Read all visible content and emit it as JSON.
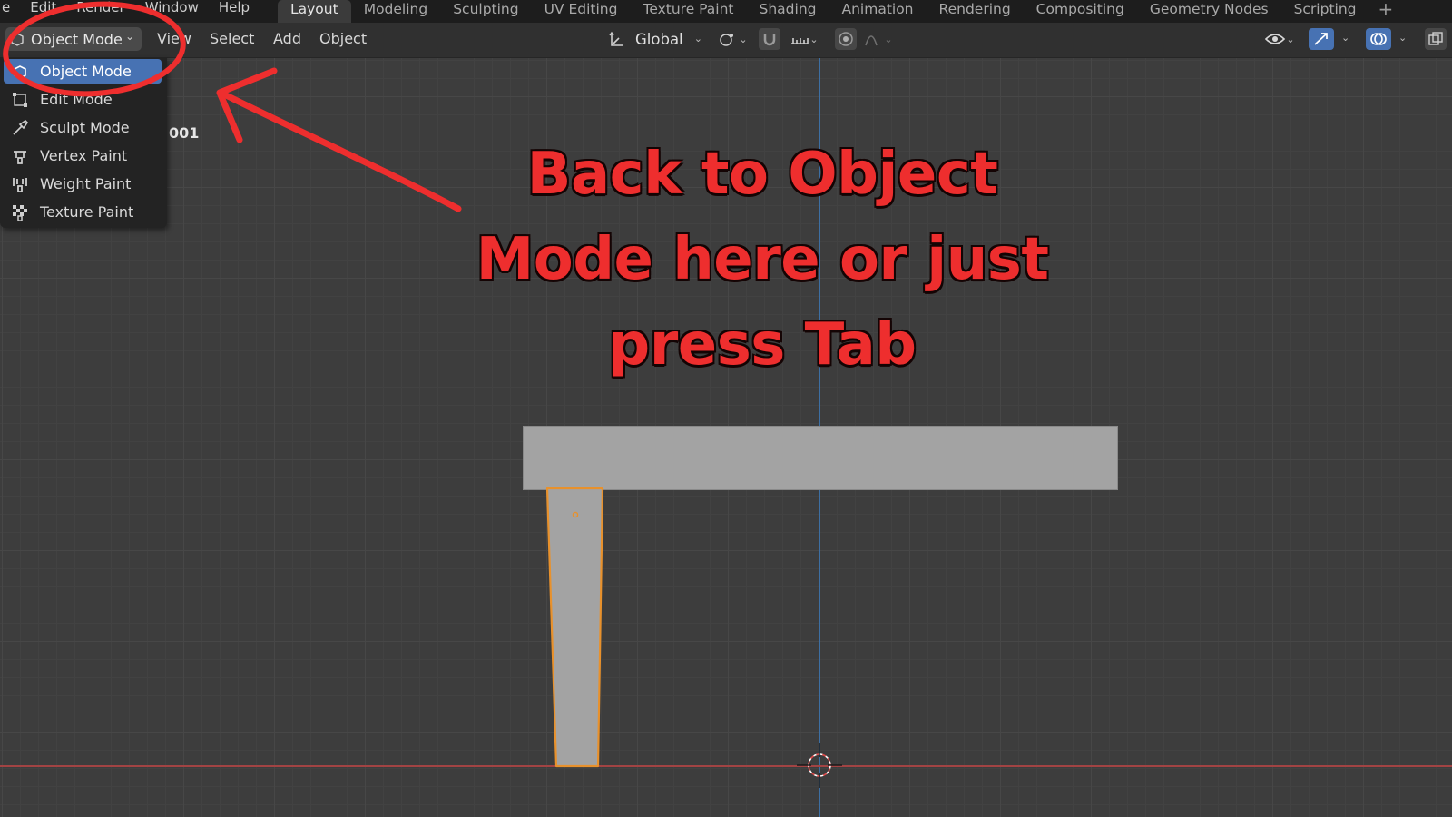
{
  "menubar": {
    "items": [
      "e",
      "Edit",
      "Render",
      "Window",
      "Help"
    ],
    "workspaces": [
      "Layout",
      "Modeling",
      "Sculpting",
      "UV Editing",
      "Texture Paint",
      "Shading",
      "Animation",
      "Rendering",
      "Compositing",
      "Geometry Nodes",
      "Scripting"
    ],
    "active_workspace": "Layout",
    "add_label": "+"
  },
  "header": {
    "mode_label": "Object Mode",
    "menus": {
      "view": "View",
      "select": "Select",
      "add": "Add",
      "object": "Object"
    },
    "transform_orientation": "Global"
  },
  "dropdown": {
    "items": [
      {
        "label": "Object Mode",
        "icon": "object-mode-icon",
        "selected": true
      },
      {
        "label": "Edit Mode",
        "icon": "edit-mode-icon"
      },
      {
        "label": "Sculpt Mode",
        "icon": "sculpt-brush-icon"
      },
      {
        "label": "Vertex Paint",
        "icon": "vertex-paint-icon"
      },
      {
        "label": "Weight Paint",
        "icon": "weight-paint-icon"
      },
      {
        "label": "Texture Paint",
        "icon": "texture-paint-icon"
      }
    ]
  },
  "viewport": {
    "object_name_fragment": "001"
  },
  "annotation": {
    "lines": [
      "Back to Object",
      "Mode here or just",
      "press Tab"
    ],
    "color": "#ee2e2e"
  },
  "colors": {
    "accent": "#4772b3",
    "selection_outline": "#e8912c",
    "y_axis": "#3d6fa3",
    "x_axis": "#a24343"
  }
}
